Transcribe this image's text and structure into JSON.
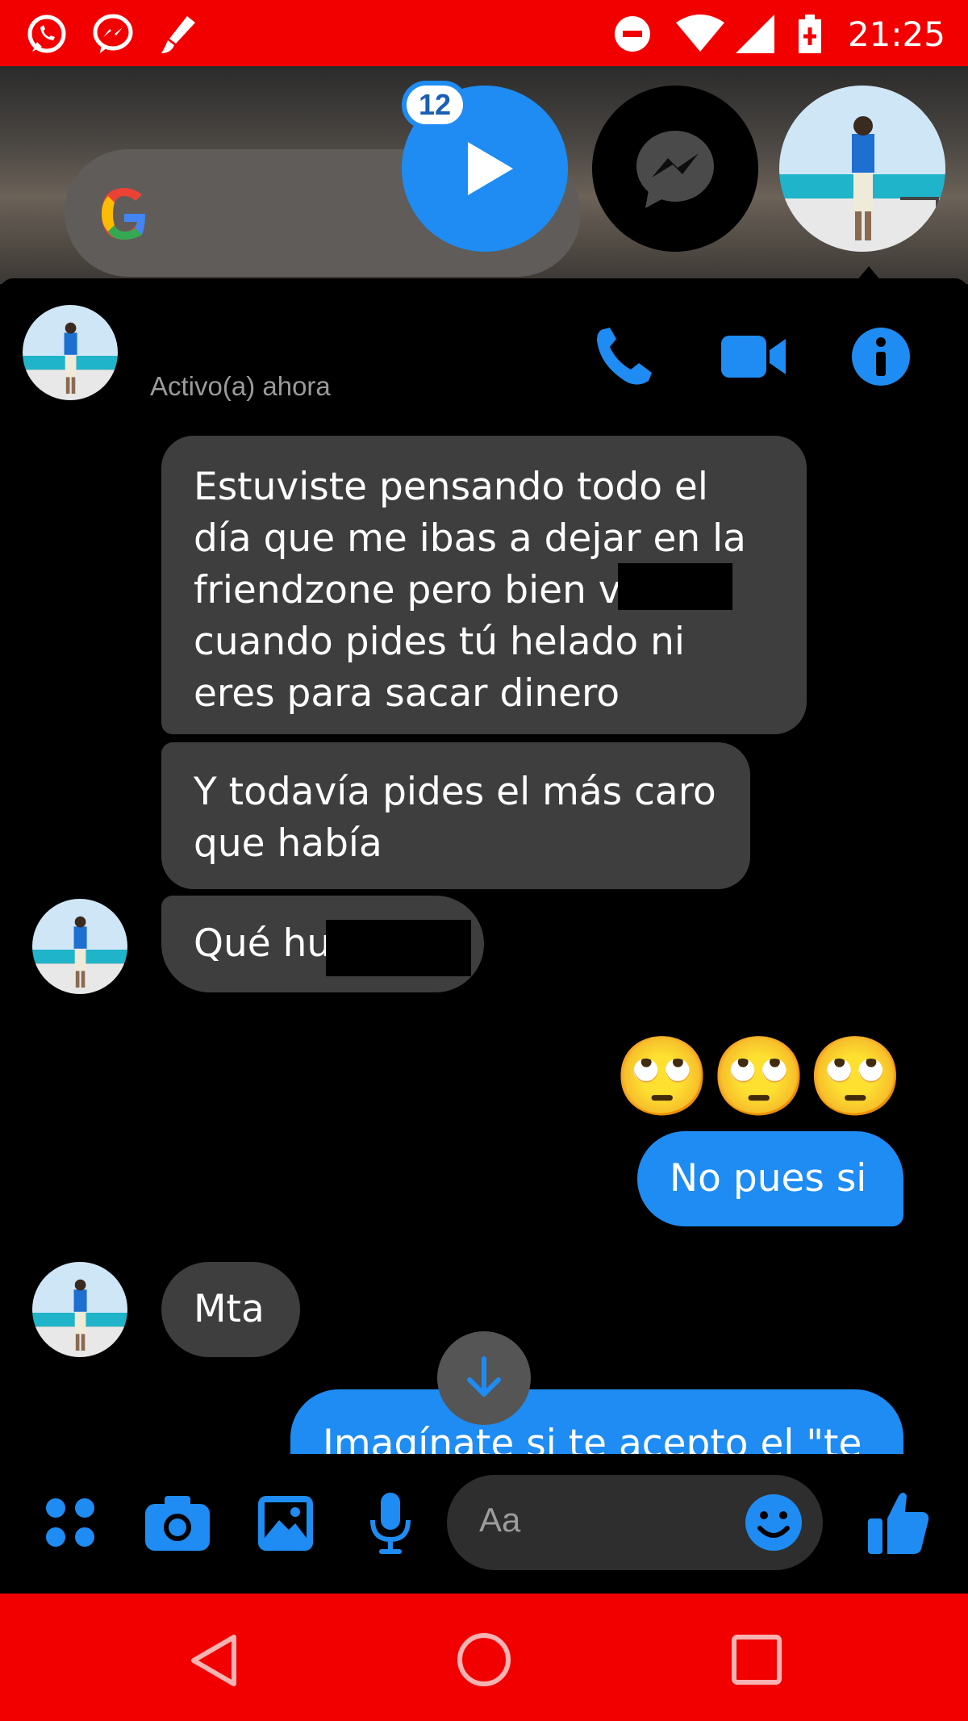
{
  "status_bar": {
    "time": "21:25",
    "left_icons": [
      "whatsapp-icon",
      "messenger-icon",
      "brush-icon"
    ],
    "right_icons": [
      "do-not-disturb-icon",
      "wifi-icon",
      "signal-icon",
      "battery-icon"
    ]
  },
  "chat_heads": {
    "unread_badge": "12"
  },
  "conversation": {
    "status": "Activo(a) ahora",
    "messages": [
      {
        "from": "them",
        "text_lines": [
          "Estuviste pensando todo el",
          "día que me ibas a dejar en la",
          "friendzone pero bien v",
          "cuando pides tú helado ni",
          "eres para sacar dinero"
        ]
      },
      {
        "from": "them",
        "text_lines": [
          "Y todavía pides el más caro",
          "que había"
        ]
      },
      {
        "from": "them",
        "text": "Qué hu"
      },
      {
        "from": "me",
        "text": "🙄🙄🙄"
      },
      {
        "from": "me",
        "text": "No pues si"
      },
      {
        "from": "them",
        "text": "Mta"
      },
      {
        "from": "me",
        "text": "Imagínate si te acepto el \"te"
      }
    ]
  },
  "composer": {
    "placeholder": "Aa"
  },
  "colors": {
    "accent": "#1e8cf2",
    "status_bar": "#f20000",
    "incoming_bubble": "#3e3e3e"
  }
}
